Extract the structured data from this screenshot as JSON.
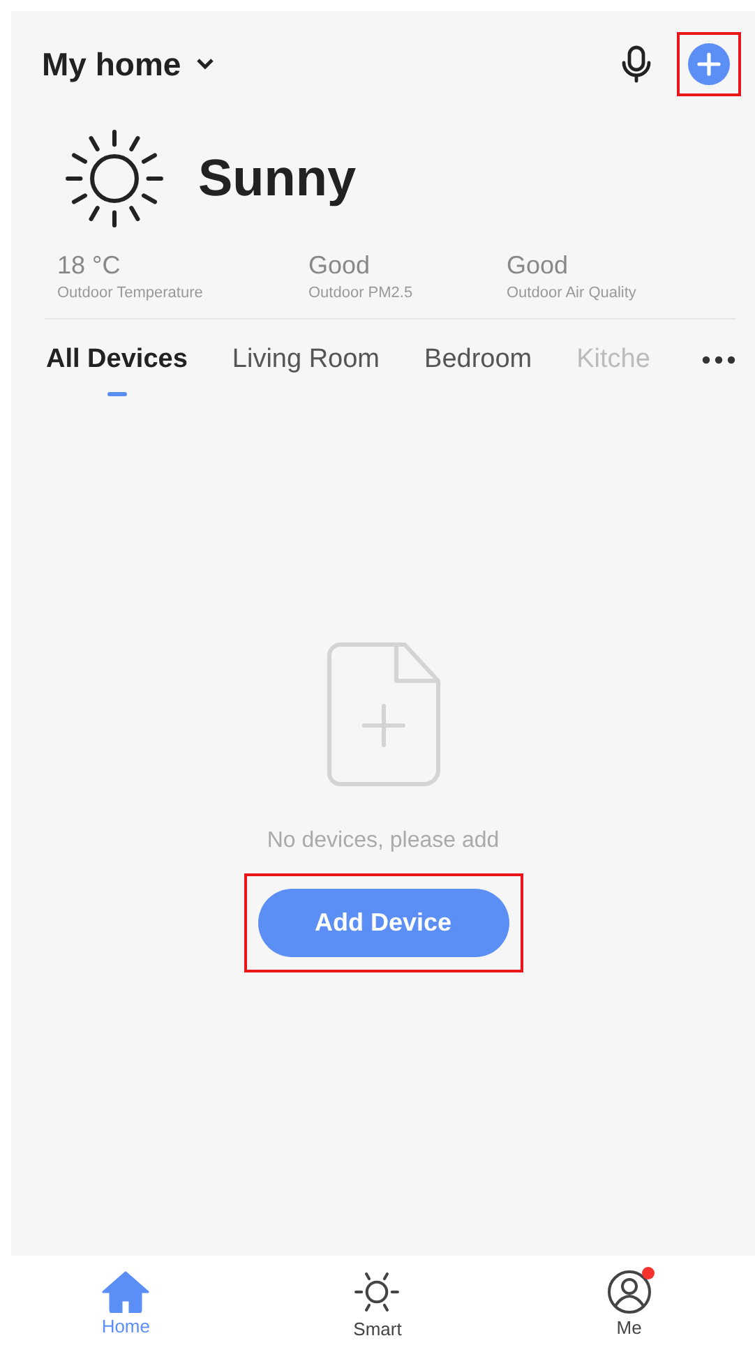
{
  "header": {
    "home_name": "My home",
    "add_highlighted": true
  },
  "weather": {
    "condition": "Sunny",
    "stats": [
      {
        "value": "18 °C",
        "label": "Outdoor Temperature"
      },
      {
        "value": "Good",
        "label": "Outdoor PM2.5"
      },
      {
        "value": "Good",
        "label": "Outdoor Air Quality"
      }
    ]
  },
  "tabs": [
    {
      "label": "All Devices",
      "selected": true
    },
    {
      "label": "Living Room",
      "selected": false
    },
    {
      "label": "Bedroom",
      "selected": false
    },
    {
      "label": "Kitche",
      "selected": false
    }
  ],
  "empty": {
    "message": "No devices, please add",
    "button": "Add Device",
    "button_highlighted": true
  },
  "nav": [
    {
      "label": "Home",
      "kind": "home",
      "selected": true,
      "badge": false
    },
    {
      "label": "Smart",
      "kind": "smart",
      "selected": false,
      "badge": false
    },
    {
      "label": "Me",
      "kind": "me",
      "selected": false,
      "badge": true
    }
  ]
}
